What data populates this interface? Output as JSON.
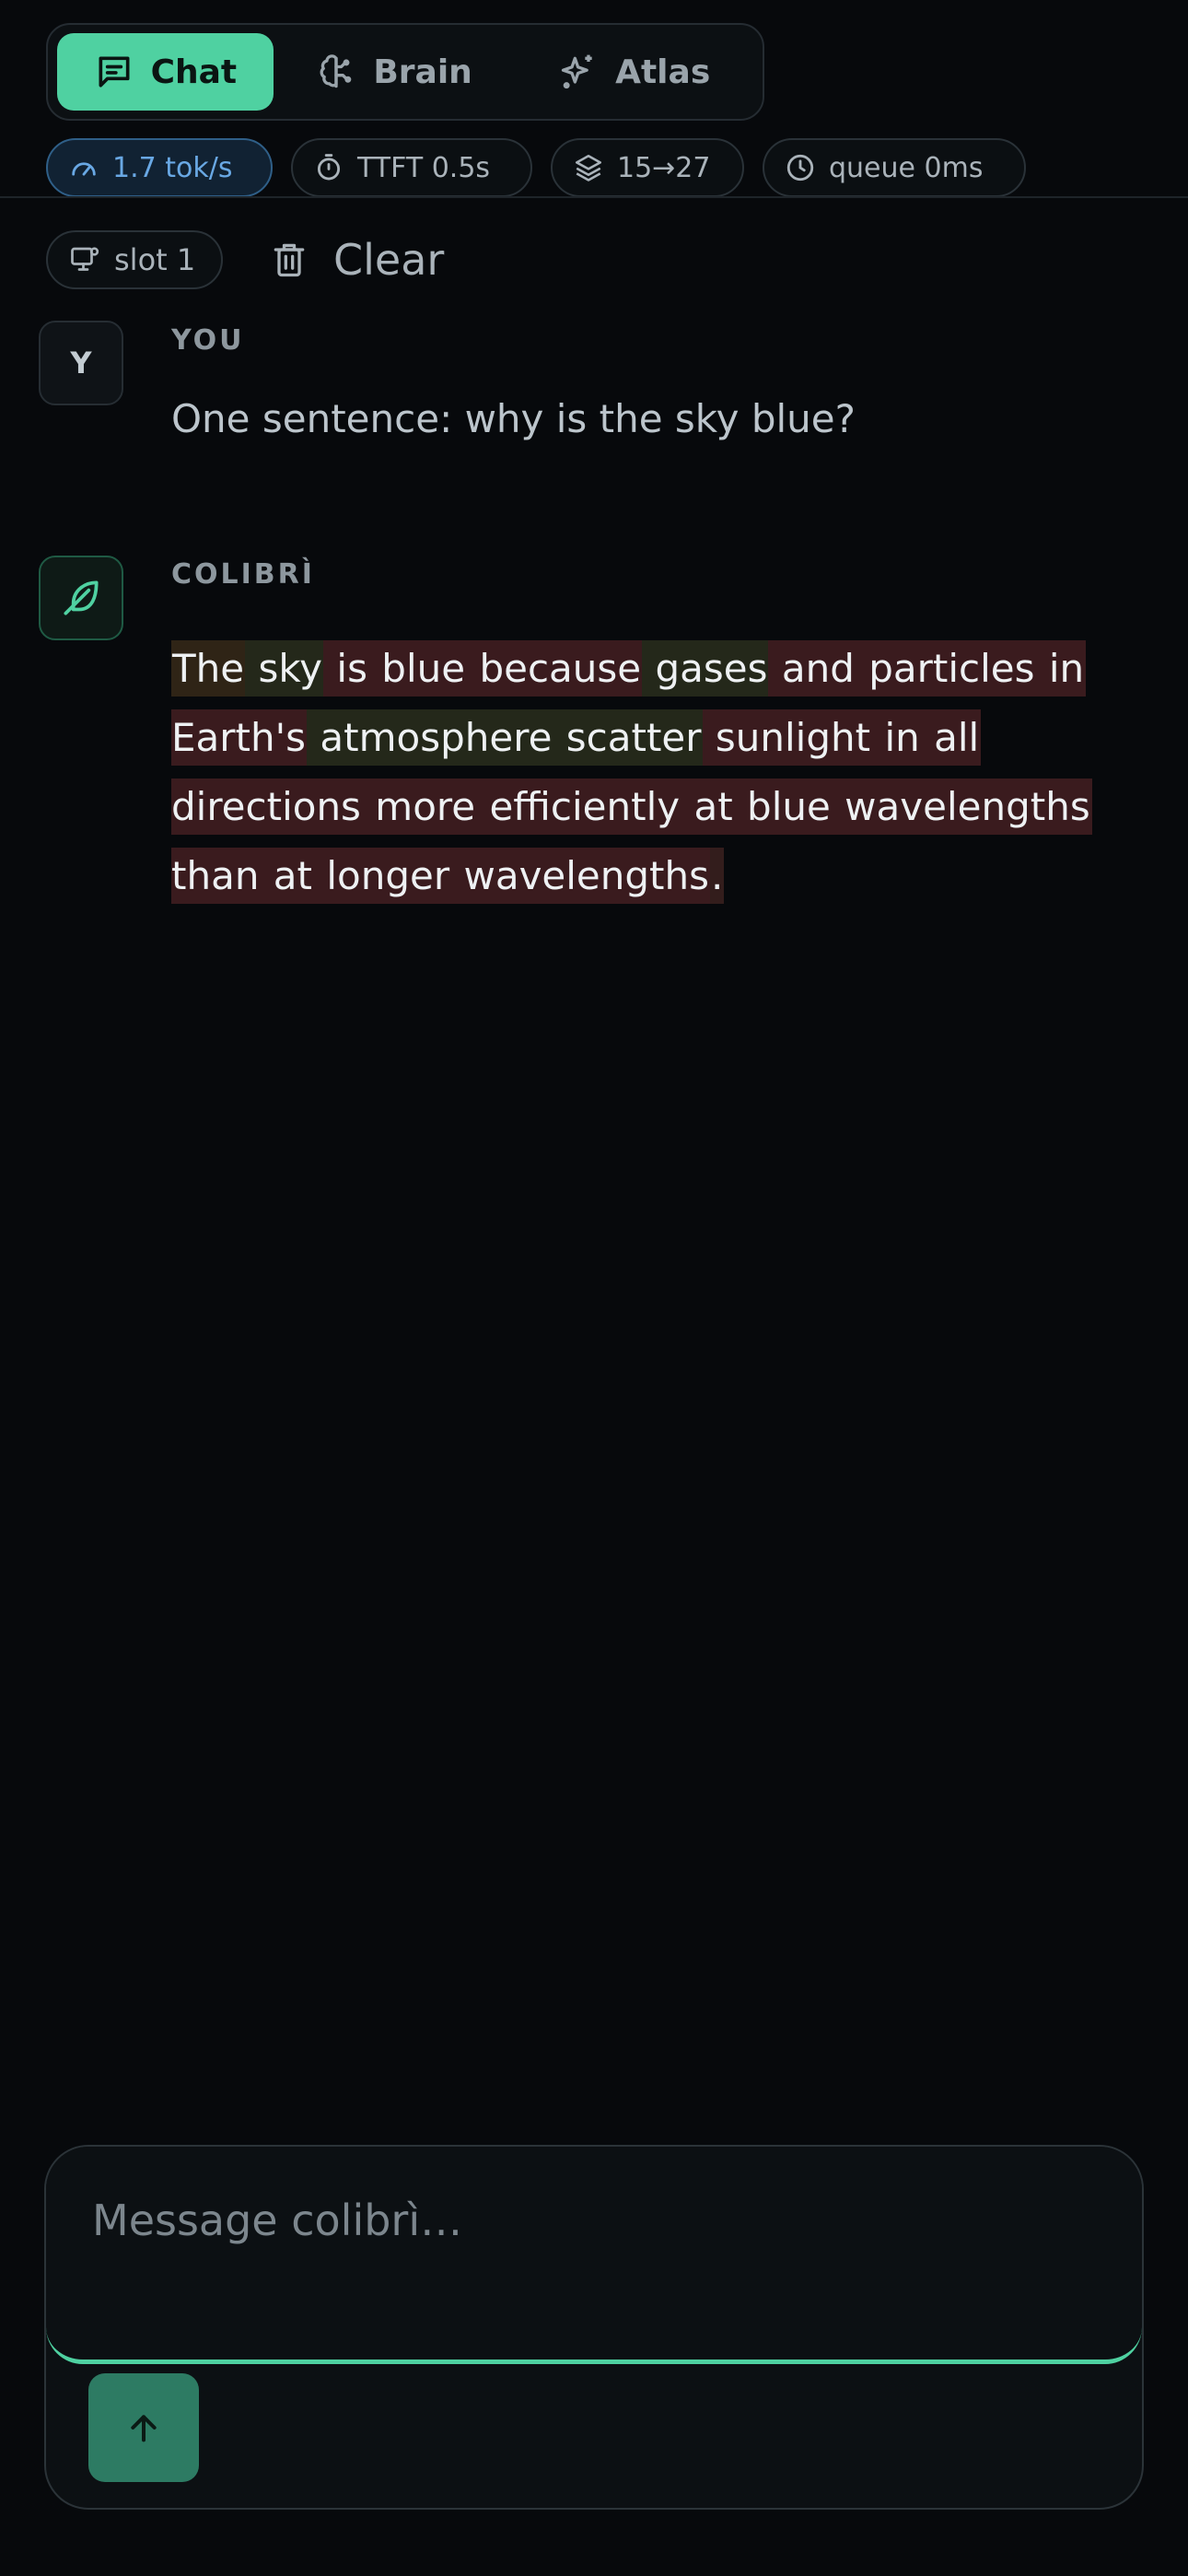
{
  "tabs": [
    {
      "label": "Chat",
      "icon": "chat-bubble-icon",
      "active": true
    },
    {
      "label": "Brain",
      "icon": "brain-icon",
      "active": false
    },
    {
      "label": "Atlas",
      "icon": "sparkles-icon",
      "active": false
    }
  ],
  "stats": {
    "throughput": "1.7 tok/s",
    "ttft": "TTFT 0.5s",
    "layers": "15→27",
    "queue": "queue 0ms"
  },
  "session": {
    "slot_label": "slot 1",
    "clear_label": "Clear"
  },
  "messages": [
    {
      "sender": "YOU",
      "avatar_letter": "Y",
      "text": "One sentence: why is the sky blue?"
    },
    {
      "sender": "COLIBRÌ",
      "avatar_icon": "feather-icon",
      "tokens": [
        {
          "text": "The",
          "shade": "t2"
        },
        {
          "text": " sky",
          "shade": "t3"
        },
        {
          "text": " is",
          "shade": "t1"
        },
        {
          "text": " blue",
          "shade": "t1"
        },
        {
          "text": " because",
          "shade": "t1"
        },
        {
          "text": " gases",
          "shade": "t3"
        },
        {
          "text": " and",
          "shade": "t1"
        },
        {
          "text": " particles",
          "shade": "t1"
        },
        {
          "text": " in",
          "shade": "t1"
        },
        {
          "text": " Earth's",
          "shade": "t1"
        },
        {
          "text": " atmosphere",
          "shade": "t3"
        },
        {
          "text": " scatter",
          "shade": "t3"
        },
        {
          "text": " sunlight",
          "shade": "t1"
        },
        {
          "text": " in",
          "shade": "t1"
        },
        {
          "text": " all",
          "shade": "t1"
        },
        {
          "text": " directions",
          "shade": "t1"
        },
        {
          "text": " more",
          "shade": "t1"
        },
        {
          "text": " efficiently",
          "shade": "t1"
        },
        {
          "text": " at",
          "shade": "t1"
        },
        {
          "text": " blue",
          "shade": "t1"
        },
        {
          "text": " wavelengths",
          "shade": "t1"
        },
        {
          "text": " than",
          "shade": "t1"
        },
        {
          "text": " at",
          "shade": "t1"
        },
        {
          "text": " longer",
          "shade": "t1"
        },
        {
          "text": " wavelengths",
          "shade": "t1"
        },
        {
          "text": ".",
          "shade": "t4"
        }
      ]
    }
  ],
  "composer": {
    "placeholder": "Message colibrì…",
    "send_icon": "arrow-up-icon"
  },
  "colors": {
    "accent": "#4fd1a1",
    "background": "#07090c",
    "throughput_blue": "#69a8e4"
  }
}
